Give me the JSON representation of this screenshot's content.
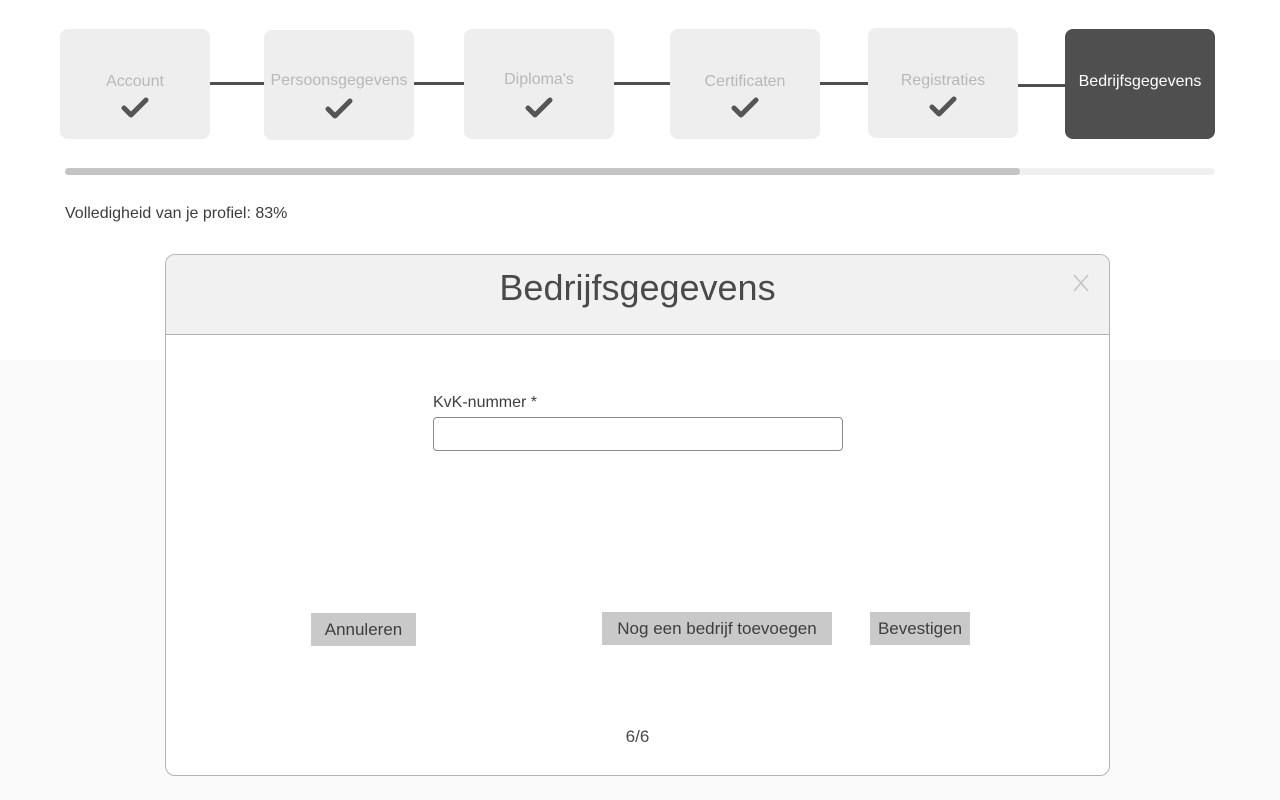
{
  "stepper": {
    "steps": [
      {
        "label": "Account",
        "completed": true,
        "active": false
      },
      {
        "label": "Persoonsgegevens",
        "completed": true,
        "active": false
      },
      {
        "label": "Diploma's",
        "completed": true,
        "active": false
      },
      {
        "label": "Certificaten",
        "completed": true,
        "active": false
      },
      {
        "label": "Registraties",
        "completed": true,
        "active": false
      },
      {
        "label": "Bedrijfsgegevens",
        "completed": false,
        "active": true
      }
    ]
  },
  "progress": {
    "percent": 83,
    "label": "Volledigheid van je profiel: 83%"
  },
  "modal": {
    "title": "Bedrijfsgegevens",
    "close_icon": "close-x-icon",
    "field": {
      "label": "KvK-nummer *",
      "value": "",
      "placeholder": ""
    },
    "buttons": {
      "cancel": "Annuleren",
      "add_another": "Nog een bedrijf toevoegen",
      "confirm": "Bevestigen"
    },
    "page_indicator": "6/6"
  },
  "colors": {
    "active_step": "#4f4f4f",
    "inactive_step": "#eeeeee",
    "progress_fill": "#c4c4c4",
    "button": "#c9c9c9"
  }
}
